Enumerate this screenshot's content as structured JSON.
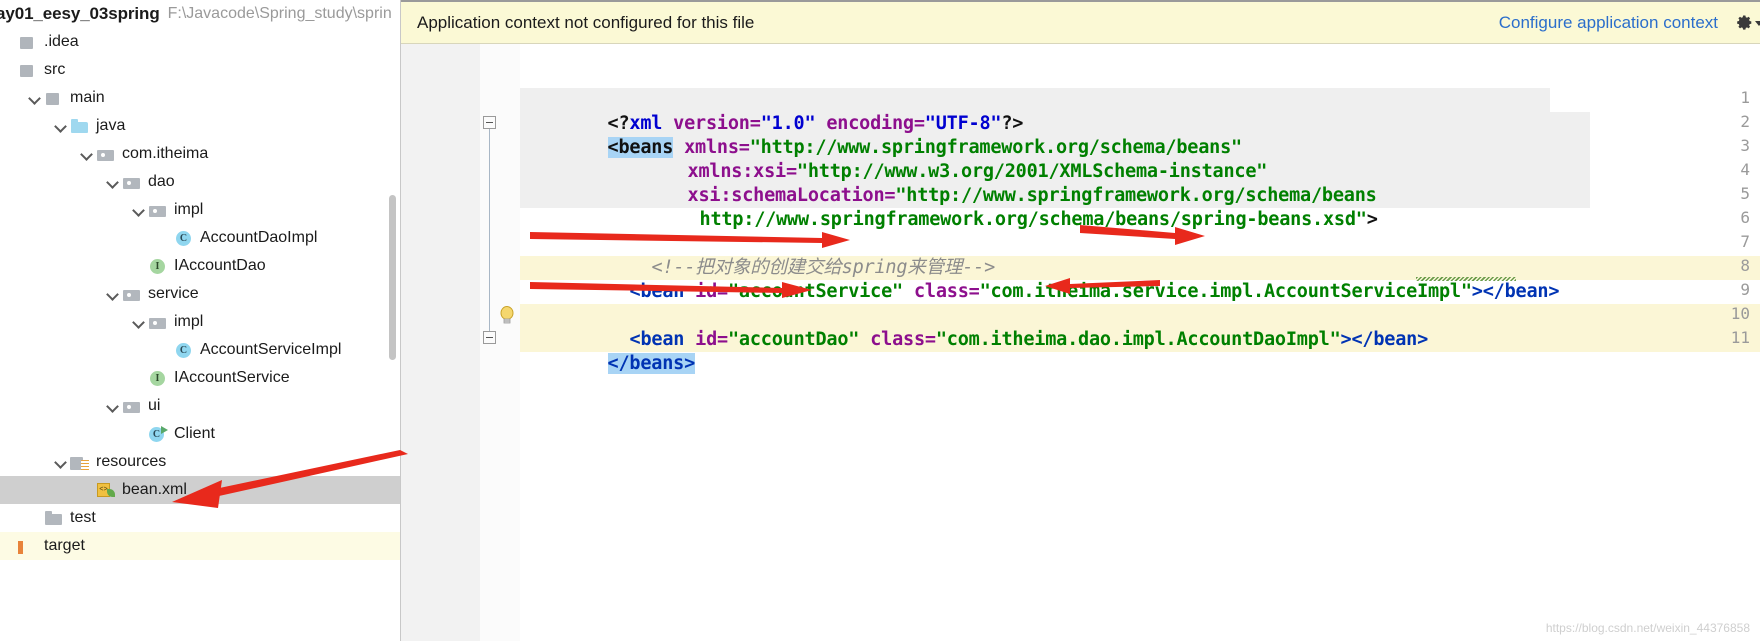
{
  "project": {
    "name": "ay01_eesy_03spring",
    "path": "F:\\Javacode\\Spring_study\\sprin",
    "tree": [
      {
        "label": ".idea",
        "indent": 0,
        "icon": "square-grey",
        "chevron": false
      },
      {
        "label": "src",
        "indent": 0,
        "icon": "square-grey",
        "chevron": false
      },
      {
        "label": "main",
        "indent": 1,
        "icon": "square-grey",
        "chevron": true
      },
      {
        "label": "java",
        "indent": 2,
        "icon": "folder-blue",
        "chevron": true
      },
      {
        "label": "com.itheima",
        "indent": 3,
        "icon": "folder-grey",
        "chevron": true
      },
      {
        "label": "dao",
        "indent": 4,
        "icon": "folder-grey",
        "chevron": true
      },
      {
        "label": "impl",
        "indent": 5,
        "icon": "folder-grey",
        "chevron": true
      },
      {
        "label": "AccountDaoImpl",
        "indent": 6,
        "icon": "class",
        "chevron": false
      },
      {
        "label": "IAccountDao",
        "indent": 5,
        "icon": "interface",
        "chevron": false
      },
      {
        "label": "service",
        "indent": 4,
        "icon": "folder-grey",
        "chevron": true
      },
      {
        "label": "impl",
        "indent": 5,
        "icon": "folder-grey",
        "chevron": true
      },
      {
        "label": "AccountServiceImpl",
        "indent": 6,
        "icon": "class",
        "chevron": false
      },
      {
        "label": "IAccountService",
        "indent": 5,
        "icon": "interface",
        "chevron": false
      },
      {
        "label": "ui",
        "indent": 4,
        "icon": "folder-grey",
        "chevron": true
      },
      {
        "label": "Client",
        "indent": 5,
        "icon": "class-runnable",
        "chevron": false
      },
      {
        "label": "resources",
        "indent": 2,
        "icon": "folder-resources",
        "chevron": true
      },
      {
        "label": "bean.xml",
        "indent": 3,
        "icon": "xml-file",
        "chevron": false,
        "selected": true
      },
      {
        "label": "test",
        "indent": 1,
        "icon": "folder-plain",
        "chevron": false
      },
      {
        "label": "target",
        "indent": 0,
        "icon": "target-marker",
        "chevron": false,
        "highlighted": true
      }
    ]
  },
  "notification": {
    "message": "Application context not configured for this file",
    "link_label": "Configure application context",
    "gear_icon": "gear-icon",
    "background_color": "#fbf9d5",
    "link_color": "#2b6ecb"
  },
  "editor": {
    "line_numbers": [
      "1",
      "2",
      "3",
      "4",
      "5",
      "6",
      "7",
      "8",
      "9",
      "10",
      "11"
    ],
    "lines": [
      {
        "n": 1,
        "text": "<?xml version=\"1.0\" encoding=\"UTF-8\"?>"
      },
      {
        "n": 2,
        "text": "<beans xmlns=\"http://www.springframework.org/schema/beans\""
      },
      {
        "n": 3,
        "text": "       xmlns:xsi=\"http://www.w3.org/2001/XMLSchema-instance\""
      },
      {
        "n": 4,
        "text": "       xsi:schemaLocation=\"http://www.springframework.org/schema/beans"
      },
      {
        "n": 5,
        "text": "        http://www.springframework.org/schema/beans/spring-beans.xsd\">"
      },
      {
        "n": 6,
        "text": ""
      },
      {
        "n": 7,
        "text": "    <!--把对象的创建交给spring来管理-->"
      },
      {
        "n": 8,
        "text": "    <bean id=\"accountService\" class=\"com.itheima.service.impl.AccountServiceImpl\"></bean>"
      },
      {
        "n": 9,
        "text": ""
      },
      {
        "n": 10,
        "text": "    <bean id=\"accountDao\" class=\"com.itheima.dao.impl.AccountDaoImpl\"></bean>"
      },
      {
        "n": 11,
        "text": "</beans>"
      }
    ],
    "tokens": {
      "xml_decl_prefix": "<?",
      "xml_decl_name": "xml",
      "attr_version": " version=",
      "val_version": "\"1.0\"",
      "attr_encoding": " encoding=",
      "val_encoding": "\"UTF-8\"",
      "xml_decl_suffix": "?>",
      "tag_beans_open": "<beans",
      "attr_xmlns": " xmlns=",
      "val_xmlns": "\"http://www.springframework.org/schema/beans\"",
      "attr_xmlns_xsi": "xmlns:xsi=",
      "val_xmlns_xsi": "\"http://www.w3.org/2001/XMLSchema-instance\"",
      "attr_schema_location": "xsi:schemaLocation=",
      "val_schema_1": "\"http://www.springframework.org/schema/beans",
      "val_schema_2": "http://www.springframework.org/schema/beans/spring-beans.xsd\"",
      "gt": ">",
      "comment": "<!--把对象的创建交给spring来管理-->",
      "tag_bean_open": "<bean",
      "attr_id": " id=",
      "val_account_service": "\"accountService\"",
      "val_account_dao": "\"accountDao\"",
      "attr_class": " class=",
      "val_class_service": "\"com.itheima.service.impl.AccountServiceImpl\"",
      "val_class_dao": "\"com.itheima.dao.impl.AccountDaoImpl\"",
      "tag_bean_close": "></bean>",
      "tag_beans_close": "</beans>",
      "bulb_icon": "lightbulb-icon",
      "fold_icon": "fold-minus-icon"
    },
    "highlight_color": "#fbf6d6",
    "selection_color": "#a8d4f5"
  },
  "annotations": {
    "arrow_color": "#e8291c",
    "arrows": [
      "arrow-to-bean-xml",
      "arrow-to-bean-id-service",
      "arrow-to-class-service",
      "arrow-to-bean-id-dao",
      "arrow-to-class-dao"
    ]
  },
  "watermark": "https://blog.csdn.net/weixin_44376858"
}
